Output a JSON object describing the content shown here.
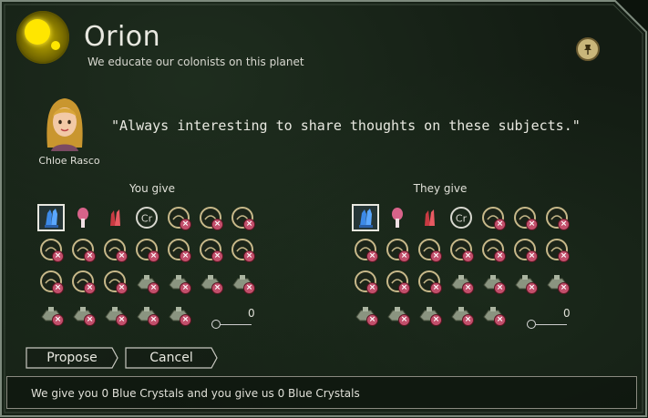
{
  "planet": {
    "name": "Orion",
    "description": "We educate our colonists on this planet"
  },
  "diplomat": {
    "name": "Chloe Rasco",
    "quote": "\"Always interesting to share thoughts on these subjects.\""
  },
  "columns": {
    "give_title": "You give",
    "receive_title": "They give"
  },
  "slider_values": {
    "give": "0",
    "receive": "0"
  },
  "buttons": {
    "propose": "Propose",
    "cancel": "Cancel"
  },
  "status": "We give you 0 Blue Crystals and you give us 0 Blue Crystals",
  "resources": [
    {
      "icon": "blue-crystal-icon",
      "state": "selected"
    },
    {
      "icon": "mushroom-icon",
      "state": "available"
    },
    {
      "icon": "red-crystal-icon",
      "state": "available"
    },
    {
      "icon": "credits-icon",
      "state": "available",
      "label": "Cr"
    },
    {
      "icon": "water-drop-icon",
      "state": "unavailable"
    },
    {
      "icon": "tech-lens-icon",
      "state": "unavailable"
    },
    {
      "icon": "tech-dome-icon",
      "state": "unavailable"
    },
    {
      "icon": "tech-disk-icon",
      "state": "unavailable"
    },
    {
      "icon": "tech-sensor-icon",
      "state": "unavailable"
    },
    {
      "icon": "tech-triangle-icon",
      "state": "unavailable"
    },
    {
      "icon": "tech-module-icon",
      "state": "unavailable"
    },
    {
      "icon": "tech-search-icon",
      "state": "unavailable"
    },
    {
      "icon": "tech-tools-icon",
      "state": "unavailable"
    },
    {
      "icon": "tech-half-disk-icon",
      "state": "unavailable"
    },
    {
      "icon": "tech-scan-icon",
      "state": "unavailable"
    },
    {
      "icon": "tech-cap-icon",
      "state": "unavailable"
    },
    {
      "icon": "tech-visor-icon",
      "state": "unavailable"
    },
    {
      "icon": "tank-unit-icon",
      "state": "unavailable"
    },
    {
      "icon": "hover-unit-icon",
      "state": "unavailable"
    },
    {
      "icon": "walker-unit-icon",
      "state": "unavailable"
    },
    {
      "icon": "artillery-unit-icon",
      "state": "unavailable"
    },
    {
      "icon": "transport-unit-icon",
      "state": "unavailable"
    },
    {
      "icon": "rocket-unit-icon",
      "state": "unavailable"
    },
    {
      "icon": "fighter-unit-icon",
      "state": "unavailable"
    },
    {
      "icon": "scout-unit-icon",
      "state": "unavailable"
    },
    {
      "icon": "saucer-unit-icon",
      "state": "unavailable"
    }
  ],
  "colors": {
    "accent_gold": "#c8b98a",
    "unavailable_badge": "#c24f6b",
    "planet_yellow": "#ffe600"
  }
}
